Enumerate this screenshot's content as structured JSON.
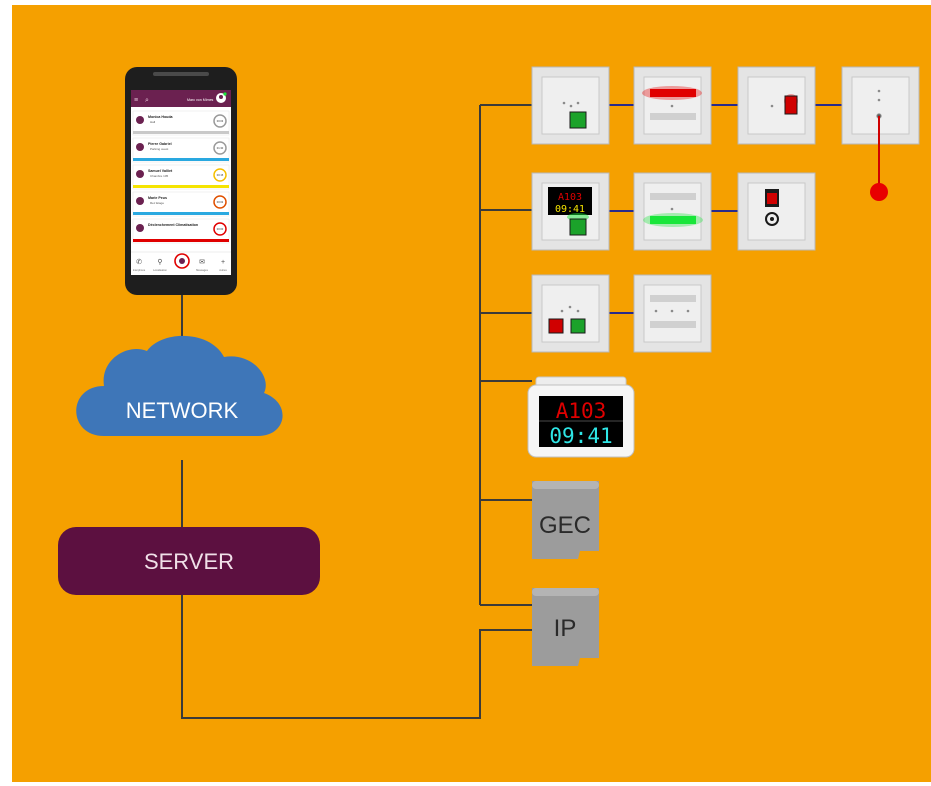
{
  "colors": {
    "background": "#F5A000",
    "cloud": "#3E76B8",
    "server": "#5C1040",
    "wire": "#3A3A3A",
    "bus": "#2A2B8A",
    "alarm_red": "#E80000",
    "lamp_green": "#19E63A",
    "button_green": "#1BA22A"
  },
  "network": {
    "label": "NETWORK"
  },
  "server": {
    "label": "SERVER"
  },
  "gateways": [
    {
      "label": "GEC"
    },
    {
      "label": "IP"
    }
  ],
  "display": {
    "room": "A103",
    "time": "09:41"
  },
  "room_terminal": {
    "room": "A103",
    "time": "09:41"
  },
  "phone": {
    "header_user": "Marc von Mimes",
    "alerts": [
      {
        "name": "Monica Houda",
        "location": "Hall",
        "timer": "00:03"
      },
      {
        "name": "Pierre Gabriel",
        "location": "Parking ouest",
        "timer": "01:30"
      },
      {
        "name": "Samuel Valliet",
        "location": "Chambre 105",
        "timer": "00:15"
      },
      {
        "name": "Marie Peus",
        "location": "Rez Etage",
        "timer": "00:02"
      },
      {
        "name": "Déclenchement Climatisation",
        "location": "",
        "timer": "00:00"
      }
    ],
    "nav": [
      "Interphone",
      "Localisation",
      "",
      "Messages",
      "Autres"
    ]
  }
}
